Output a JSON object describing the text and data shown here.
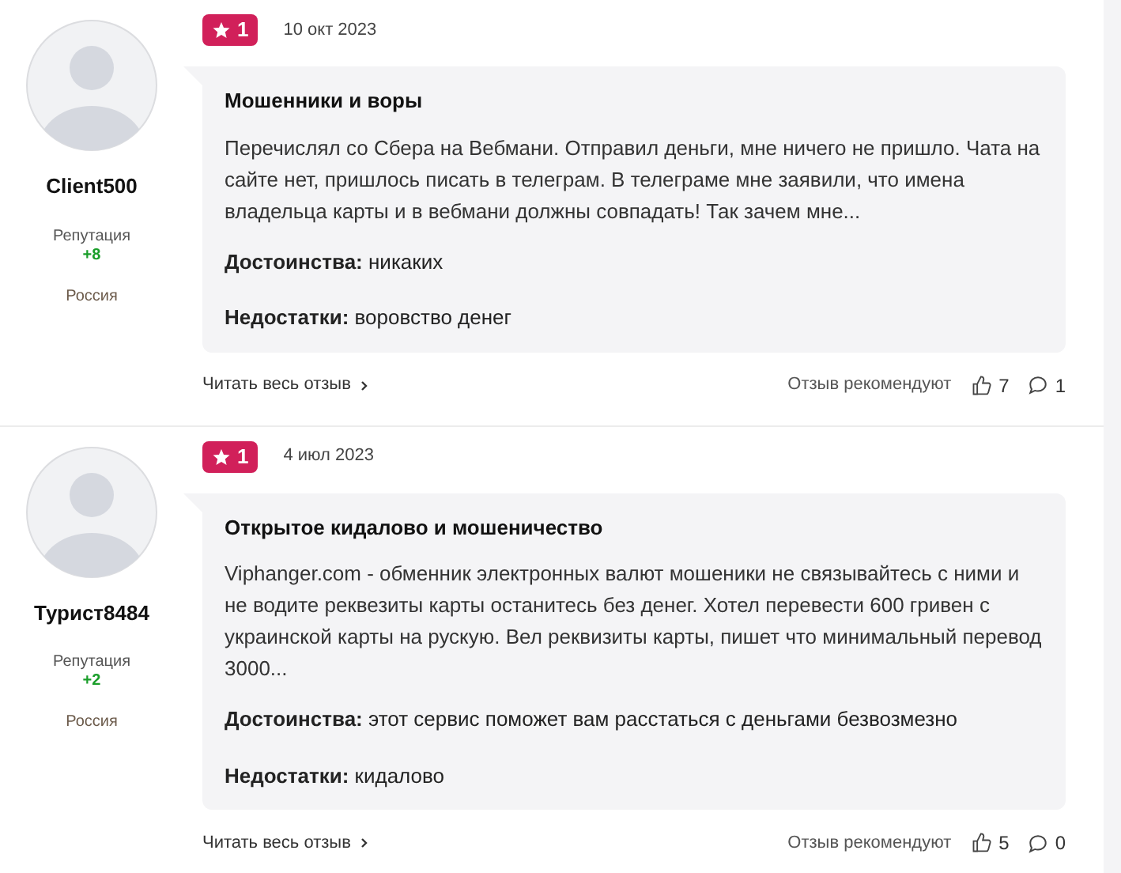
{
  "reviews": [
    {
      "author": "Client500",
      "reputation_label": "Репутация",
      "reputation": "+8",
      "country": "Россия",
      "rating": "1",
      "date": "10 окт 2023",
      "title": "Мошенники и воры",
      "text": "Перечислял со Сбера на Вебмани. Отправил деньги, мне ничего не пришло. Чата на сайте нет, пришлось писать в телеграм. В телеграме мне заявили, что имена владельца карты и в вебмани должны совпадать! Так зачем мне...",
      "pros": "**Достоинства:** никаких",
      "cons": "**Недостатки:** воровство денег",
      "read_more": "Читать весь отзыв",
      "recommend_label": "Отзыв рекомендуют",
      "likes": "7",
      "comments": "1"
    },
    {
      "author": "Турист8484",
      "reputation_label": "Репутация",
      "reputation": "+2",
      "country": "Россия",
      "rating": "1",
      "date": "4 июл 2023",
      "title": "Открытое кидалово и мошеничество",
      "text": "Viphanger.com - обменник электронных валют мошеники не связывайтесь с ними и не водите реквезиты карты останитесь без денег. Хотел перевести 600 гривен с украинской карты на рускую. Вел реквизиты карты, пишет что минимальный перевод 3000...",
      "pros": "**Достоинства:** этот сервис поможет вам расстаться с деньгами безвозмезно",
      "cons": "**Недостатки:** кидалово",
      "read_more": "Читать весь отзыв",
      "recommend_label": "Отзыв рекомендуют",
      "likes": "5",
      "comments": "0"
    }
  ]
}
